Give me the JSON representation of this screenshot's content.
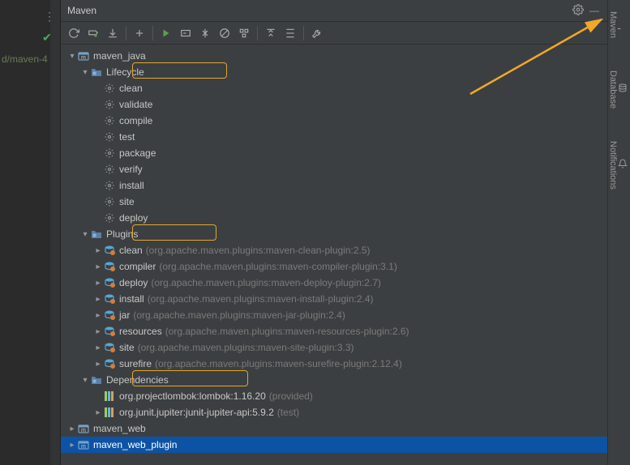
{
  "panel": {
    "title": "Maven"
  },
  "gutter": {
    "text": "d/maven-4"
  },
  "right_tabs": {
    "maven": "Maven",
    "database": "Database",
    "notifications": "Notifications"
  },
  "tree": {
    "root": "maven_java",
    "lifecycle": {
      "label": "Lifecycle",
      "goals": [
        "clean",
        "validate",
        "compile",
        "test",
        "package",
        "verify",
        "install",
        "site",
        "deploy"
      ]
    },
    "plugins": {
      "label": "Plugins",
      "items": [
        {
          "name": "clean",
          "coords": "(org.apache.maven.plugins:maven-clean-plugin:2.5)"
        },
        {
          "name": "compiler",
          "coords": "(org.apache.maven.plugins:maven-compiler-plugin:3.1)"
        },
        {
          "name": "deploy",
          "coords": "(org.apache.maven.plugins:maven-deploy-plugin:2.7)"
        },
        {
          "name": "install",
          "coords": "(org.apache.maven.plugins:maven-install-plugin:2.4)"
        },
        {
          "name": "jar",
          "coords": "(org.apache.maven.plugins:maven-jar-plugin:2.4)"
        },
        {
          "name": "resources",
          "coords": "(org.apache.maven.plugins:maven-resources-plugin:2.6)"
        },
        {
          "name": "site",
          "coords": "(org.apache.maven.plugins:maven-site-plugin:3.3)"
        },
        {
          "name": "surefire",
          "coords": "(org.apache.maven.plugins:maven-surefire-plugin:2.12.4)"
        }
      ]
    },
    "deps": {
      "label": "Dependencies",
      "items": [
        {
          "name": "org.projectlombok:lombok:1.16.20",
          "scope": "(provided)"
        },
        {
          "name": "org.junit.jupiter:junit-jupiter-api:5.9.2",
          "scope": "(test)"
        }
      ]
    },
    "siblings": [
      "maven_web",
      "maven_web_plugin"
    ]
  }
}
